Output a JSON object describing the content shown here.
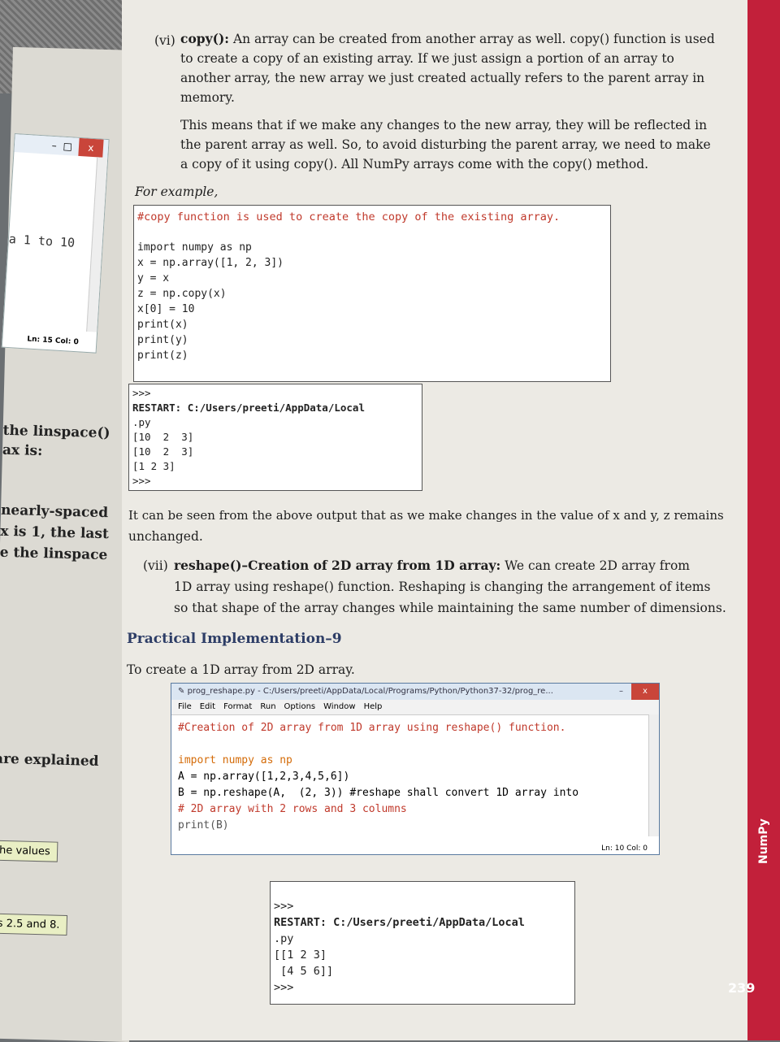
{
  "left_fragments": {
    "window_close": "x",
    "code_line": "a 1 to 10",
    "status": "Ln: 15   Col: 0",
    "lines": [
      "the linspace()",
      "ax is:",
      "nearly-spaced",
      "x is 1, the last",
      "e the linspace",
      "are explained"
    ],
    "notes": [
      "he values",
      "s 2.5 and 8."
    ]
  },
  "section_vi": {
    "label": "(vi)",
    "heading": "copy():",
    "line1": "An array can be created from another array as well. copy() function is used",
    "line2": "to create a copy of an existing array. If we just assign a portion of an array to",
    "line3": "another array, the new array we just created actually refers to the parent array in",
    "line4": "memory.",
    "para2_line1": "This means that if we make any changes to the new array, they will be reflected in",
    "para2_line2": "the parent array as well. So, to avoid disturbing the parent array, we need to make",
    "para2_line3": "a copy of it using copy(). All NumPy arrays come with the copy() method."
  },
  "for_example": "For example,",
  "code1": {
    "comment": "#copy function is used to create the copy of the existing array.",
    "lines": [
      "import numpy as np",
      "x = np.array([1, 2, 3])",
      "y = x",
      "z = np.copy(x)",
      "x[0] = 10",
      "print(x)",
      "print(y)",
      "print(z)"
    ]
  },
  "output1": {
    "lines": [
      ">>>",
      "RESTART: C:/Users/preeti/AppData/Local",
      ".py",
      "[10  2  3]",
      "[10  2  3]",
      "[1 2 3]",
      ">>>"
    ]
  },
  "explanation": {
    "line1": "It can be seen from the above output that as we make changes in the value of x and y, z remains",
    "line2": "unchanged."
  },
  "section_vii": {
    "label": "(vii)",
    "heading": "reshape()–Creation of 2D array from 1D array:",
    "line1": "We can create 2D array from",
    "line2": "1D array using reshape() function. Reshaping is changing the arrangement of items",
    "line3": "so that shape of the array changes while maintaining the same number of dimensions."
  },
  "practical": {
    "label": "Practical Implementation–9",
    "task": "To create a 1D array from 2D array."
  },
  "idle_window": {
    "title": "prog_reshape.py - C:/Users/preeti/AppData/Local/Programs/Python/Python37-32/prog_re...",
    "min": "–",
    "max": "□",
    "close": "x",
    "menu": [
      "File",
      "Edit",
      "Format",
      "Run",
      "Options",
      "Window",
      "Help"
    ],
    "lines": [
      "#Creation of 2D array from 1D array using reshape() function.",
      "",
      "import numpy as np",
      "A = np.array([1,2,3,4,5,6])",
      "B = np.reshape(A,  (2, 3)) #reshape shall convert 1D array into",
      "# 2D array with 2 rows and 3 columns",
      "print(B)"
    ],
    "status": "Ln: 10   Col: 0"
  },
  "output2": {
    "lines": [
      ">>>",
      "RESTART: C:/Users/preeti/AppData/Local",
      ".py",
      "[[1 2 3]",
      " [4 5 6]]",
      ">>>"
    ]
  },
  "side_label": "NumPy",
  "page_number": "239"
}
